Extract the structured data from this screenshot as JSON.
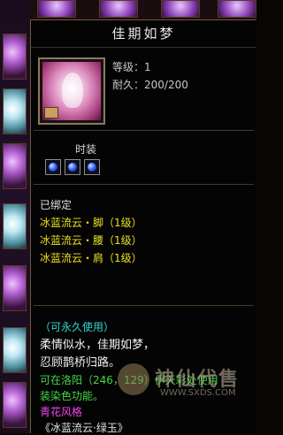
{
  "tooltip": {
    "title": "佳期如梦",
    "level": "等级：1",
    "durability": "耐久：200/200",
    "type_label": "时装",
    "gems": [
      "blue-orb-icon",
      "blue-orb-icon",
      "blue-orb-icon"
    ],
    "bound_status": "已绑定",
    "set_items": [
      "冰蓝流云・脚（1级）",
      "冰蓝流云・腰（1级）",
      "冰蓝流云・肩（1级）"
    ],
    "usage": "（可永久使用）",
    "description": [
      "柔情似水，佳期如梦，",
      "忍顾鹊桥归路。"
    ],
    "green_lines": [
      "可在洛阳（246，129）伊天彩处使用",
      "装染色功能。"
    ],
    "style": "青花风格",
    "last_line": "《冰蓝流云·绿玉》"
  },
  "watermark": {
    "brand": "神仙代售",
    "url": "WWW.SXDS.COM"
  },
  "colors": {
    "title": "#e8e8e8",
    "set_yellow": "#e8e020",
    "usage_cyan": "#33d8d0",
    "green": "#44d844",
    "style_magenta": "#ee44ee"
  }
}
